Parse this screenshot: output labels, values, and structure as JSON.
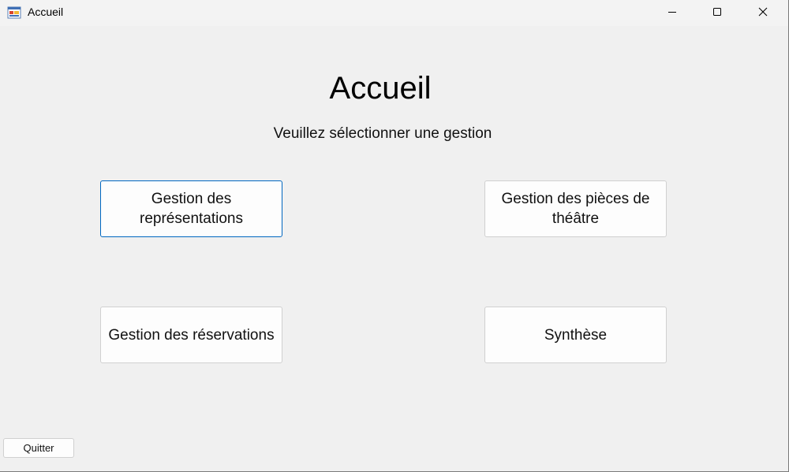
{
  "window": {
    "title": "Accueil",
    "controls": [
      "minimize-icon",
      "maximize-icon",
      "close-icon"
    ]
  },
  "main": {
    "heading": "Accueil",
    "subtitle": "Veuillez sélectionner une gestion",
    "buttons": [
      {
        "label": "Gestion des représentations",
        "focused": true
      },
      {
        "label": "Gestion des pièces de théâtre",
        "focused": false
      },
      {
        "label": "Gestion des réservations",
        "focused": false
      },
      {
        "label": "Synthèse",
        "focused": false
      }
    ]
  },
  "footer": {
    "quit_label": "Quitter"
  },
  "colors": {
    "background": "#f0f0f0",
    "focus_border": "#0067c0"
  }
}
